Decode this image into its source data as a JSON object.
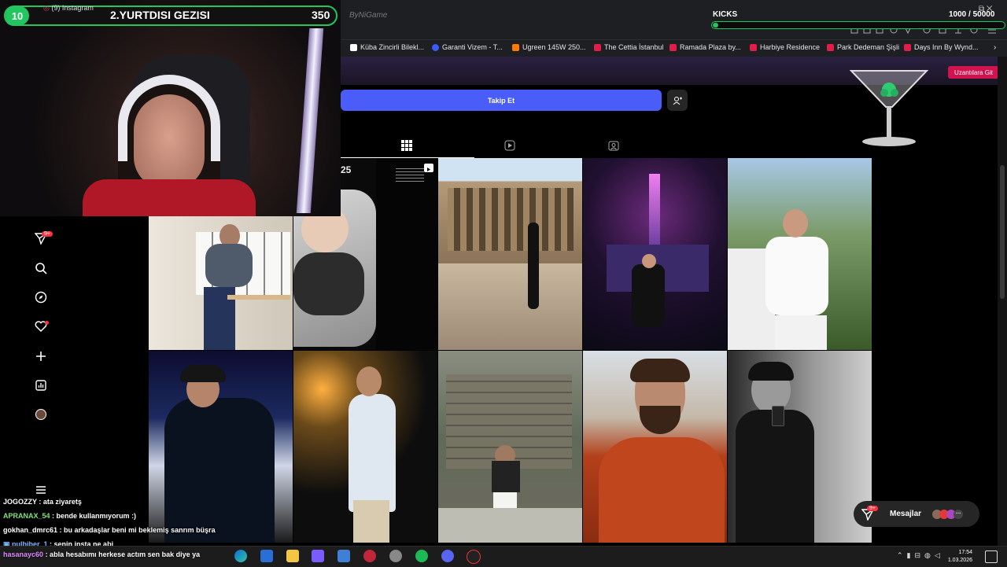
{
  "stream": {
    "goal_level": "10",
    "goal_title": "2.YURTDISI GEZISI",
    "goal_count": "350",
    "tab_title": "(9) Instagram",
    "watermark": "ByNiGame",
    "kicks_label": "KICKS",
    "kicks_count": "1000  / 50000",
    "kicks_progress": 0.02
  },
  "bookmarks": [
    "Küba Zincirli Bilekl...",
    "Garanti Vizem - T...",
    "Ugreen 145W 250...",
    "The Cettia İstanbul",
    "Ramada Plaza by...",
    "Harbiye Residence",
    "Park Dedeman Şişli",
    "Days Inn By Wynd..."
  ],
  "extension_button": "Uzantılara Git",
  "profile": {
    "follow_label": "Takip Et",
    "post_overlay_text": "25"
  },
  "sidebar": {
    "notification_badge": "9+"
  },
  "messages": {
    "label": "Mesajlar",
    "badge": "9+"
  },
  "chat": [
    {
      "user": "JOGOZZY",
      "text": ": ata ziyaretş",
      "color": "#ffffff"
    },
    {
      "user": "APRANAX_54",
      "text": ": bende kullanmıyorum :)",
      "color": "#7ee37e"
    },
    {
      "user": "gokhan_dmrc61",
      "text": ": bu arkadaşlar beni mi beklemiş sanrım büşra",
      "color": "#ffffff"
    },
    {
      "user": "pulbiber_1",
      "text": ": senin insta ne abi",
      "color": "#7ab8ff"
    },
    {
      "user": "hasanayc60",
      "text": ": abla hesabımı herkese actım sen bak diye ya",
      "color": "#e08aff"
    }
  ],
  "taskbar": {
    "time": "17:54",
    "date": "1.03.2026"
  },
  "colors": {
    "follow_blue": "#4a5df9",
    "kick_green": "#22c55e",
    "extension_red": "#d0134f"
  }
}
